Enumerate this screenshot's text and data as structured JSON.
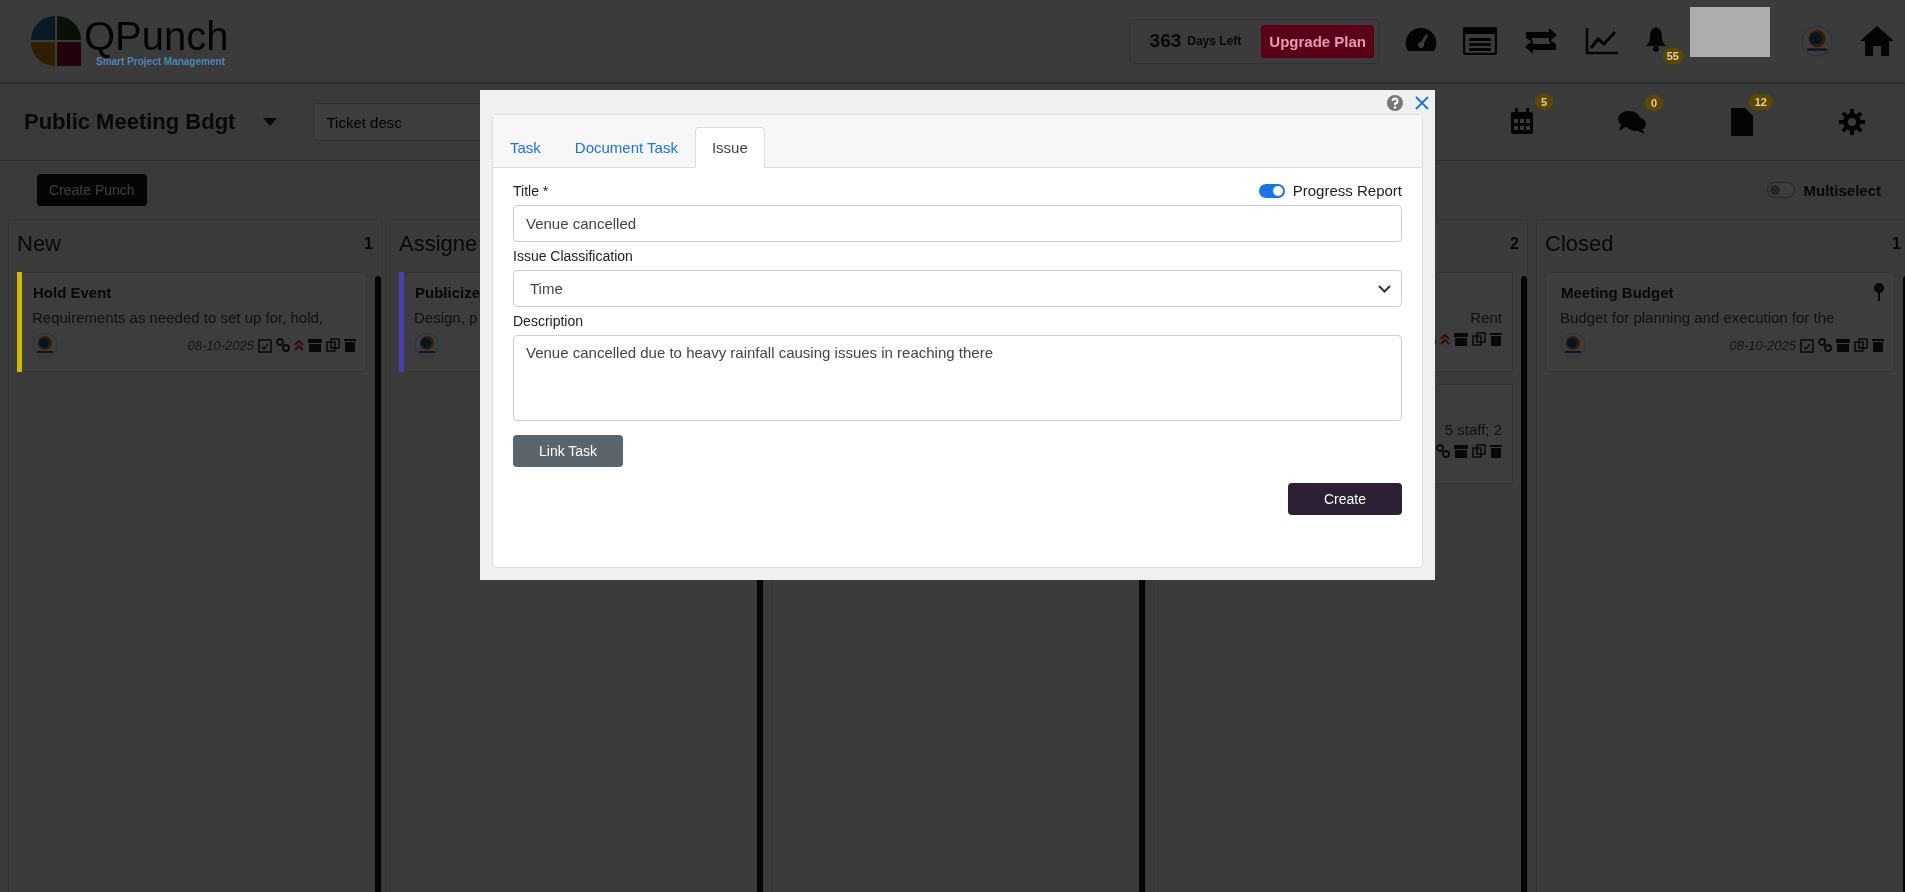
{
  "header": {
    "logo_title": "QPunch",
    "logo_subtitle": "Smart Project Management",
    "days_count": "363",
    "days_label": "Days Left",
    "upgrade_button": "Upgrade Plan",
    "notification_count": "55"
  },
  "toolbar": {
    "project_name": "Public Meeting Bdgt",
    "search": {
      "placeholder": "Ticket desc"
    },
    "actions": [
      {
        "kind": "calendar",
        "badge": "5"
      },
      {
        "kind": "chat",
        "badge": "0"
      },
      {
        "kind": "file",
        "badge": "12"
      },
      {
        "kind": "settings"
      }
    ]
  },
  "create_button": "Create Punch",
  "multiselect": {
    "label": "Multiselect",
    "on": false
  },
  "columns": [
    {
      "title": "New",
      "count": "1",
      "cards": [
        {
          "title": "Hold Event",
          "description": "Requirements as needed to set up for, hold,",
          "date": "08-10-2025",
          "color": "#d4b800",
          "high_priority": true,
          "pinned": false,
          "clipped": false
        }
      ]
    },
    {
      "title": "Assigne",
      "cards": [
        {
          "title": "Publicize",
          "description": "Design, p",
          "color": "#4b3fb0",
          "pinned": false,
          "clipped": false
        }
      ]
    },
    {},
    {
      "count": "2",
      "cards": [
        {
          "description": "Rent",
          "high_priority": true,
          "pinned": false,
          "clipped": true
        },
        {
          "description": "5 staff; 2",
          "high_priority": false,
          "pinned": false,
          "clipped": true
        }
      ]
    },
    {
      "title": "Closed",
      "count": "1",
      "cards": [
        {
          "title": "Meeting Budget",
          "description": "Budget for planning and execution for the",
          "date": "08-10-2025",
          "high_priority": false,
          "pinned": true,
          "clipped": false
        }
      ]
    }
  ],
  "modal": {
    "tabs": [
      {
        "label": "Task",
        "selected": false
      },
      {
        "label": "Document Task",
        "selected": false
      },
      {
        "label": "Issue",
        "selected": true
      }
    ],
    "title_label": "Title *",
    "progress_report": {
      "label": "Progress Report",
      "on": true
    },
    "title_value": "Venue cancelled",
    "classification_label": "Issue Classification",
    "classification_value": "Time",
    "description_label": "Description",
    "description_value": "Venue cancelled due to heavy rainfall causing issues in reaching there",
    "link_button": "Link Task",
    "create_button": "Create"
  }
}
